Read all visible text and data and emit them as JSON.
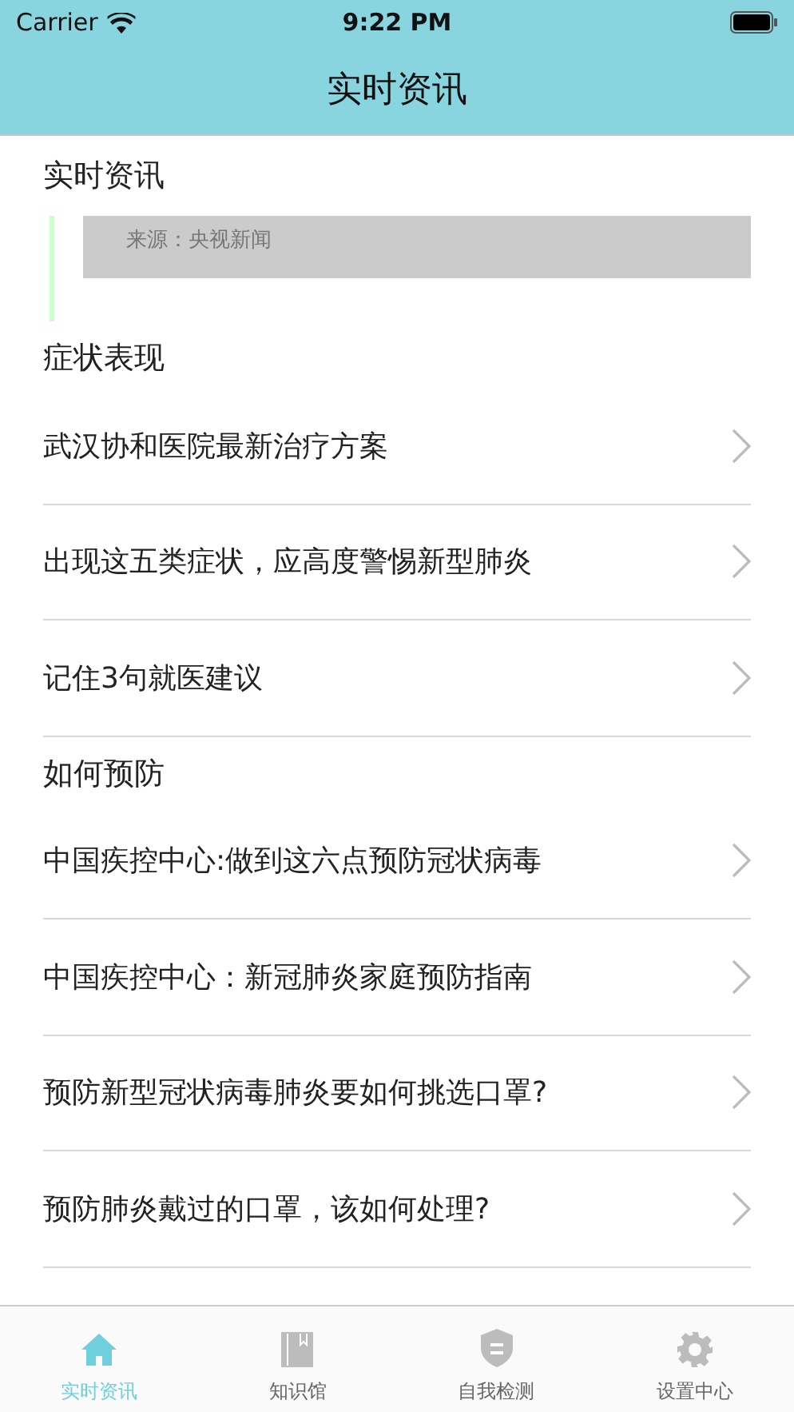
{
  "status_bar": {
    "carrier": "Carrier",
    "time": "9:22 PM"
  },
  "nav_bar": {
    "title": "实时资讯"
  },
  "news": {
    "heading": "实时资讯",
    "source": "来源：央视新闻"
  },
  "sections": [
    {
      "heading": "症状表现",
      "items": [
        "武汉协和医院最新治疗方案",
        "出现这五类症状，应高度警惕新型肺炎",
        "记住3句就医建议"
      ]
    },
    {
      "heading": "如何预防",
      "items": [
        "中国疾控中心:做到这六点预防冠状病毒",
        "中国疾控中心：新冠肺炎家庭预防指南",
        "预防新型冠状病毒肺炎要如何挑选口罩?",
        "预防肺炎戴过的口罩，该如何处理?"
      ]
    }
  ],
  "tabs": [
    {
      "label": "实时资讯",
      "selected": true
    },
    {
      "label": "知识馆",
      "selected": false
    },
    {
      "label": "自我检测",
      "selected": false
    },
    {
      "label": "设置中心",
      "selected": false
    }
  ]
}
